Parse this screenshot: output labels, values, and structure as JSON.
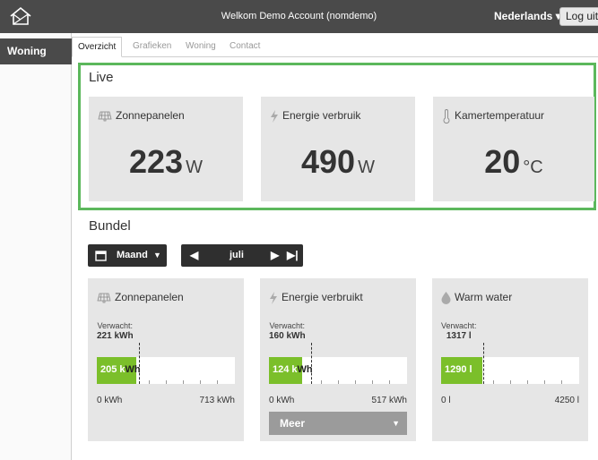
{
  "header": {
    "welcome": "Welkom Demo Account (nomdemo)",
    "language": "Nederlands ▾",
    "logout_label": "Log uit"
  },
  "sidebar": {
    "items": [
      {
        "label": "Woning"
      }
    ]
  },
  "tabs": [
    {
      "label": "Overzicht",
      "active": true
    },
    {
      "label": "Grafieken"
    },
    {
      "label": "Woning"
    },
    {
      "label": "Contact"
    }
  ],
  "live": {
    "title": "Live",
    "cards": [
      {
        "label": "Zonnepanelen",
        "icon": "solar-panel-icon",
        "value": "223",
        "unit": "W"
      },
      {
        "label": "Energie verbruik",
        "icon": "lightning-icon",
        "value": "490",
        "unit": "W"
      },
      {
        "label": "Kamertemperatuur",
        "icon": "thermometer-icon",
        "value": "20",
        "unit": "°C"
      }
    ]
  },
  "bundel": {
    "title": "Bundel",
    "period_select": "Maand",
    "month": "juli",
    "cards": [
      {
        "label": "Zonnepanelen",
        "icon": "solar-panel-icon",
        "expected_label": "Verwacht:",
        "expected_value": "221 kWh",
        "current_value": "205 k",
        "current_rest": "Wh",
        "axis_min": "0 kWh",
        "axis_max": "713 kWh",
        "fill_fraction": 0.288,
        "expected_fraction": 0.31
      },
      {
        "label": "Energie verbruikt",
        "icon": "lightning-icon",
        "expected_label": "Verwacht:",
        "expected_value": "160 kWh",
        "current_value": "124 k",
        "current_rest": "Wh",
        "axis_min": "0 kWh",
        "axis_max": "517 kWh",
        "fill_fraction": 0.24,
        "expected_fraction": 0.31,
        "more_label": "Meer"
      },
      {
        "label": "Warm water",
        "icon": "water-drop-icon",
        "expected_label": "Verwacht:",
        "expected_value": "1317 l",
        "current_value": "1290 l",
        "current_rest": "",
        "axis_min": "0 l",
        "axis_max": "4250 l",
        "fill_fraction": 0.3,
        "expected_fraction": 0.31
      }
    ]
  },
  "colors": {
    "accent_green": "#5cb85c",
    "bar_green": "#7bbf2a",
    "topbar": "#4a4a4a"
  }
}
